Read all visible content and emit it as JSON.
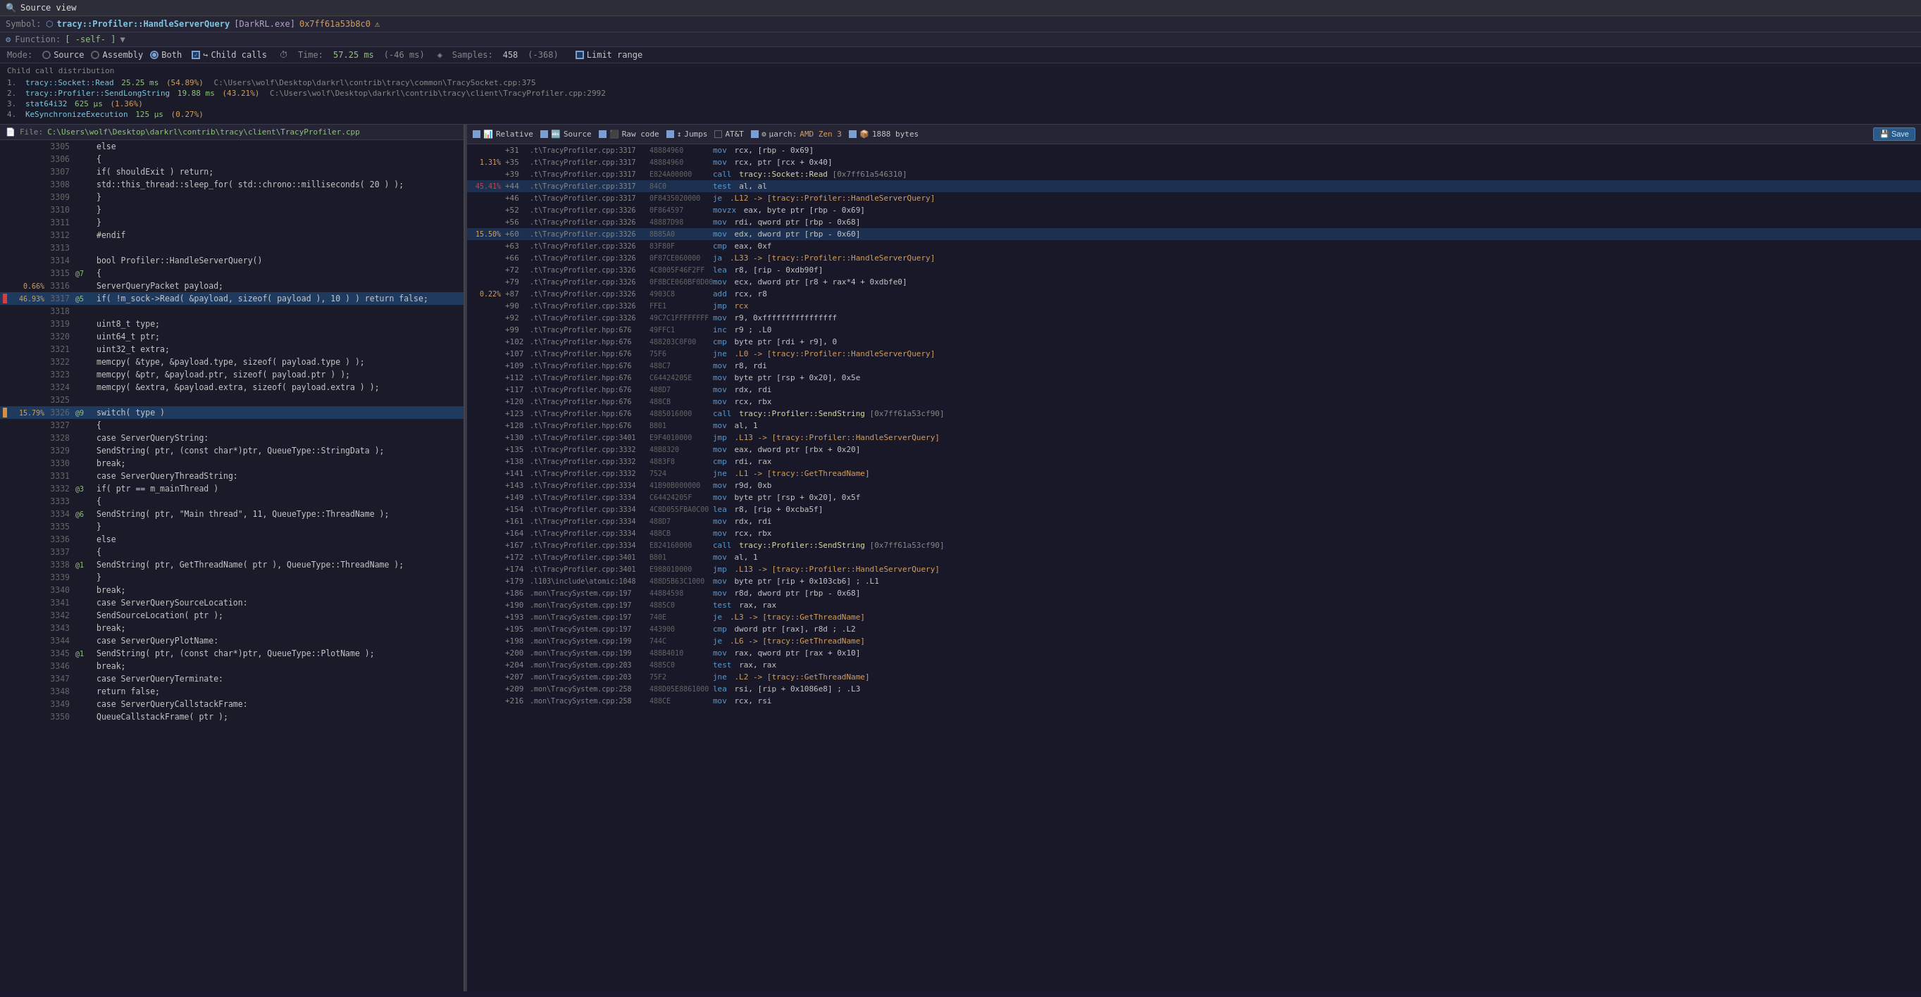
{
  "titleBar": {
    "icon": "👁",
    "title": "Source view"
  },
  "symbolBar": {
    "label": "Symbol:",
    "name": "tracy::Profiler::HandleServerQuery",
    "module": "[DarkRL.exe]",
    "addr": "0x7ff61a53b8c0",
    "warnIcon": "⚠"
  },
  "functionBar": {
    "label": "Function:",
    "value": "[ -self- ]",
    "dropdown": true
  },
  "modeBar": {
    "modeLabel": "Mode:",
    "modes": [
      {
        "id": "source",
        "label": "Source",
        "active": false
      },
      {
        "id": "assembly",
        "label": "Assembly",
        "active": false
      },
      {
        "id": "both",
        "label": "Both",
        "active": true
      }
    ],
    "childCalls": {
      "label": "Child calls",
      "checked": true
    },
    "time": {
      "label": "Time:",
      "value": "57.25 ms",
      "delta": "(-46 ms)"
    },
    "samples": {
      "label": "Samples:",
      "value": "458",
      "delta": "(-368)"
    },
    "limitRange": {
      "label": "Limit range",
      "checked": false
    }
  },
  "childCallsDist": {
    "header": "Child call distribution",
    "items": [
      {
        "num": "1.",
        "func": "tracy::Socket::Read",
        "time": "25.25 ms",
        "pct": "(54.89%)",
        "path": "C:\\Users\\wolf\\Desktop\\darkrl\\contrib\\tracy\\common\\TracySocket.cpp:375"
      },
      {
        "num": "2.",
        "func": "tracy::Profiler::SendLongString",
        "time": "19.88 ms",
        "pct": "(43.21%)",
        "path": "C:\\Users\\wolf\\Desktop\\darkrl\\contrib\\tracy\\client\\TracyProfiler.cpp:2992"
      },
      {
        "num": "3.",
        "func": "stat64i32",
        "time": "625 μs",
        "pct": "(1.36%)",
        "path": ""
      },
      {
        "num": "4.",
        "func": "KeSynchronizeExecution",
        "time": "125 μs",
        "pct": "(0.27%)",
        "path": ""
      }
    ]
  },
  "sourcePanel": {
    "fileLabel": "File:",
    "filePath": "C:\\Users\\wolf\\Desktop\\darkrl\\contrib\\tracy\\client\\TracyProfiler.cpp",
    "lines": [
      {
        "num": 3305,
        "pct": "",
        "annot": "",
        "code": "else",
        "indent": 3
      },
      {
        "num": 3306,
        "pct": "",
        "annot": "",
        "code": "{",
        "indent": 4
      },
      {
        "num": 3307,
        "pct": "",
        "annot": "",
        "code": "if( shouldExit ) return;",
        "indent": 5
      },
      {
        "num": 3308,
        "pct": "",
        "annot": "",
        "code": "std::this_thread::sleep_for( std::chrono::milliseconds( 20 ) );",
        "indent": 5
      },
      {
        "num": 3309,
        "pct": "",
        "annot": "",
        "code": "}",
        "indent": 4
      },
      {
        "num": 3310,
        "pct": "",
        "annot": "",
        "code": "}",
        "indent": 3
      },
      {
        "num": 3311,
        "pct": "",
        "annot": "",
        "code": "}",
        "indent": 2
      },
      {
        "num": 3312,
        "pct": "",
        "annot": "",
        "code": "#endif",
        "indent": 1
      },
      {
        "num": 3313,
        "pct": "",
        "annot": "",
        "code": "",
        "indent": 0
      },
      {
        "num": 3314,
        "pct": "",
        "annot": "",
        "code": "bool Profiler::HandleServerQuery()",
        "indent": 1
      },
      {
        "num": 3315,
        "pct": "",
        "annot": "@7",
        "code": "{",
        "indent": 1
      },
      {
        "num": 3316,
        "pct": "0.66%",
        "annot": "",
        "code": "ServerQueryPacket payload;",
        "indent": 2
      },
      {
        "num": 3317,
        "pct": "46.93%",
        "annot": "@5",
        "code": "if( !m_sock->Read( &payload, sizeof( payload ), 10 ) ) return false;",
        "indent": 2,
        "hot": true
      },
      {
        "num": 3318,
        "pct": "",
        "annot": "",
        "code": "",
        "indent": 0
      },
      {
        "num": 3319,
        "pct": "",
        "annot": "",
        "code": "uint8_t type;",
        "indent": 2
      },
      {
        "num": 3320,
        "pct": "",
        "annot": "",
        "code": "uint64_t ptr;",
        "indent": 2
      },
      {
        "num": 3321,
        "pct": "",
        "annot": "",
        "code": "uint32_t extra;",
        "indent": 2
      },
      {
        "num": 3322,
        "pct": "",
        "annot": "",
        "code": "memcpy( &type, &payload.type, sizeof( payload.type ) );",
        "indent": 2
      },
      {
        "num": 3323,
        "pct": "",
        "annot": "",
        "code": "memcpy( &ptr, &payload.ptr, sizeof( payload.ptr ) );",
        "indent": 2
      },
      {
        "num": 3324,
        "pct": "",
        "annot": "",
        "code": "memcpy( &extra, &payload.extra, sizeof( payload.extra ) );",
        "indent": 2
      },
      {
        "num": 3325,
        "pct": "",
        "annot": "",
        "code": "",
        "indent": 0
      },
      {
        "num": 3326,
        "pct": "15.79%",
        "annot": "@9",
        "code": "switch( type )",
        "indent": 2,
        "warm": true
      },
      {
        "num": 3327,
        "pct": "",
        "annot": "",
        "code": "{",
        "indent": 2
      },
      {
        "num": 3328,
        "pct": "",
        "annot": "",
        "code": "case ServerQueryString:",
        "indent": 2
      },
      {
        "num": 3329,
        "pct": "",
        "annot": "",
        "code": "SendString( ptr, (const char*)ptr, QueueType::StringData );",
        "indent": 3
      },
      {
        "num": 3330,
        "pct": "",
        "annot": "",
        "code": "break;",
        "indent": 3
      },
      {
        "num": 3331,
        "pct": "",
        "annot": "",
        "code": "case ServerQueryThreadString:",
        "indent": 2
      },
      {
        "num": 3332,
        "pct": "",
        "annot": "@3",
        "code": "if( ptr == m_mainThread )",
        "indent": 3
      },
      {
        "num": 3333,
        "pct": "",
        "annot": "",
        "code": "{",
        "indent": 4
      },
      {
        "num": 3334,
        "pct": "",
        "annot": "@6",
        "code": "SendString( ptr, \"Main thread\", 11, QueueType::ThreadName );",
        "indent": 4
      },
      {
        "num": 3335,
        "pct": "",
        "annot": "",
        "code": "}",
        "indent": 4
      },
      {
        "num": 3336,
        "pct": "",
        "annot": "",
        "code": "else",
        "indent": 3
      },
      {
        "num": 3337,
        "pct": "",
        "annot": "",
        "code": "{",
        "indent": 4
      },
      {
        "num": 3338,
        "pct": "",
        "annot": "@1",
        "code": "SendString( ptr, GetThreadName( ptr ), QueueType::ThreadName );",
        "indent": 4
      },
      {
        "num": 3339,
        "pct": "",
        "annot": "",
        "code": "}",
        "indent": 4
      },
      {
        "num": 3340,
        "pct": "",
        "annot": "",
        "code": "break;",
        "indent": 3
      },
      {
        "num": 3341,
        "pct": "",
        "annot": "",
        "code": "case ServerQuerySourceLocation:",
        "indent": 2
      },
      {
        "num": 3342,
        "pct": "",
        "annot": "",
        "code": "SendSourceLocation( ptr );",
        "indent": 3
      },
      {
        "num": 3343,
        "pct": "",
        "annot": "",
        "code": "break;",
        "indent": 3
      },
      {
        "num": 3344,
        "pct": "",
        "annot": "",
        "code": "case ServerQueryPlotName:",
        "indent": 2
      },
      {
        "num": 3345,
        "pct": "",
        "annot": "@1",
        "code": "SendString( ptr, (const char*)ptr, QueueType::PlotName );",
        "indent": 3
      },
      {
        "num": 3346,
        "pct": "",
        "annot": "",
        "code": "break;",
        "indent": 3
      },
      {
        "num": 3347,
        "pct": "",
        "annot": "",
        "code": "case ServerQueryTerminate:",
        "indent": 2
      },
      {
        "num": 3348,
        "pct": "",
        "annot": "",
        "code": "return false;",
        "indent": 3
      },
      {
        "num": 3349,
        "pct": "",
        "annot": "",
        "code": "case ServerQueryCallstackFrame:",
        "indent": 2
      },
      {
        "num": 3350,
        "pct": "",
        "annot": "",
        "code": "QueueCallstackFrame( ptr );",
        "indent": 3
      }
    ]
  },
  "asmPanel": {
    "toggles": [
      {
        "id": "relative",
        "label": "Relative",
        "checked": true,
        "icon": "📊"
      },
      {
        "id": "source",
        "label": "Source",
        "checked": true,
        "icon": "📄"
      },
      {
        "id": "rawcode",
        "label": "Raw code",
        "checked": true,
        "icon": "🔤"
      },
      {
        "id": "jumps",
        "label": "Jumps",
        "checked": true,
        "icon": "↕"
      },
      {
        "id": "att",
        "label": "AT&T",
        "checked": false
      },
      {
        "id": "uarch",
        "label": "μarch:",
        "value": "AMD Zen 3",
        "checked": true,
        "icon": "⚙"
      },
      {
        "id": "bytes",
        "label": "1888 bytes",
        "checked": true
      },
      {
        "id": "save",
        "label": "Save",
        "isButton": true
      }
    ],
    "lines": [
      {
        "offset": "+31",
        "src": ".t\\TracyProfiler.cpp:3317",
        "bytes": "48884960",
        "pct": "",
        "instr": "mov",
        "ops": "rcx, [rbp - 0x69]"
      },
      {
        "offset": "+35",
        "src": ".t\\TracyProfiler.cpp:3317",
        "bytes": "48884960",
        "pct": "1.31%",
        "instr": "mov",
        "ops": "rcx, ptr [rcx + 0x40]"
      },
      {
        "offset": "+39",
        "src": ".t\\TracyProfiler.cpp:3317",
        "bytes": "E824A00000",
        "pct": "",
        "instr": "call",
        "ops": "tracy::Socket::Read [0x7ff61a546310]"
      },
      {
        "offset": "+44",
        "src": ".t\\TracyProfiler.cpp:3317",
        "bytes": "84C0",
        "pct": "45.41%",
        "instr": "test",
        "ops": "al, al",
        "hot": true
      },
      {
        "offset": "+46",
        "src": ".t\\TracyProfiler.cpp:3317",
        "bytes": "0F8435020000",
        "pct": "",
        "instr": "je",
        "ops": ".L12 -> [tracy::Profiler::HandleServerQuery]"
      },
      {
        "offset": "+52",
        "src": ".t\\TracyProfiler.cpp:3326",
        "bytes": "0F864597",
        "pct": "",
        "instr": "movzx",
        "ops": "eax, byte ptr [rbp - 0x69]"
      },
      {
        "offset": "+56",
        "src": ".t\\TracyProfiler.cpp:3326",
        "bytes": "48887D98",
        "pct": "",
        "instr": "mov",
        "ops": "rdi, qword ptr [rbp - 0x68]"
      },
      {
        "offset": "+60",
        "src": ".t\\TracyProfiler.cpp:3326",
        "bytes": "8B85A0",
        "pct": "15.50%",
        "instr": "mov",
        "ops": "edx, dword ptr [rbp - 0x60]",
        "warm": true
      },
      {
        "offset": "+63",
        "src": ".t\\TracyProfiler.cpp:3326",
        "bytes": "83F80F",
        "pct": "",
        "instr": "cmp",
        "ops": "eax, 0xf"
      },
      {
        "offset": "+66",
        "src": ".t\\TracyProfiler.cpp:3326",
        "bytes": "0F87CE060000",
        "pct": "",
        "instr": "ja",
        "ops": ".L33 -> [tracy::Profiler::HandleServerQuery]"
      },
      {
        "offset": "+72",
        "src": ".t\\TracyProfiler.cpp:3326",
        "bytes": "4C8005F46F2FF",
        "pct": "",
        "instr": "lea",
        "ops": "r8, [rip - 0xdb90f]"
      },
      {
        "offset": "+79",
        "src": ".t\\TracyProfiler.cpp:3326",
        "bytes": "0F8BCE060BF0D00",
        "pct": "",
        "instr": "mov",
        "ops": "ecx, dword ptr [r8 + rax*4 + 0xdbfe0]"
      },
      {
        "offset": "+87",
        "src": ".t\\TracyProfiler.cpp:3326",
        "bytes": "4903C8",
        "pct": "0.22%",
        "instr": "add",
        "ops": "rcx, r8"
      },
      {
        "offset": "+90",
        "src": ".t\\TracyProfiler.cpp:3326",
        "bytes": "FFE1",
        "pct": "",
        "instr": "jmp",
        "ops": "rcx"
      },
      {
        "offset": "+92",
        "src": ".t\\TracyProfiler.cpp:3326",
        "bytes": "49C7C1FFFFFFFF",
        "pct": "",
        "instr": "mov",
        "ops": "r9, 0xffffffffffffffff"
      },
      {
        "offset": "+99",
        "src": ".t\\TracyProfiler.hpp:676",
        "bytes": "49FFC1",
        "pct": "",
        "instr": "inc",
        "ops": "r9 ; .L0"
      },
      {
        "offset": "+102",
        "src": ".t\\TracyProfiler.hpp:676",
        "bytes": "488203C0F00",
        "pct": "",
        "instr": "cmp",
        "ops": "byte ptr [rdi + r9], 0"
      },
      {
        "offset": "+107",
        "src": ".t\\TracyProfiler.hpp:676",
        "bytes": "75F6",
        "pct": "",
        "instr": "jne",
        "ops": ".L0 -> [tracy::Profiler::HandleServerQuery]"
      },
      {
        "offset": "+109",
        "src": ".t\\TracyProfiler.hpp:676",
        "bytes": "488C7",
        "pct": "",
        "instr": "mov",
        "ops": "r8, rdi"
      },
      {
        "offset": "+112",
        "src": ".t\\TracyProfiler.hpp:676",
        "bytes": "C64424205E",
        "pct": "",
        "instr": "mov",
        "ops": "byte ptr [rsp + 0x20], 0x5e"
      },
      {
        "offset": "+117",
        "src": ".t\\TracyProfiler.hpp:676",
        "bytes": "488D7",
        "pct": "",
        "instr": "mov",
        "ops": "rdx, rdi"
      },
      {
        "offset": "+120",
        "src": ".t\\TracyProfiler.hpp:676",
        "bytes": "488CB",
        "pct": "",
        "instr": "mov",
        "ops": "rcx, rbx"
      },
      {
        "offset": "+123",
        "src": ".t\\TracyProfiler.hpp:676",
        "bytes": "4885016000",
        "pct": "",
        "instr": "call",
        "ops": "tracy::Profiler::SendString [0x7ff61a53cf90]"
      },
      {
        "offset": "+128",
        "src": ".t\\TracyProfiler.hpp:676",
        "bytes": "B801",
        "pct": "",
        "instr": "mov",
        "ops": "al, 1"
      },
      {
        "offset": "+130",
        "src": ".t\\TracyProfiler.cpp:3401",
        "bytes": "E9F4010000",
        "pct": "",
        "instr": "jmp",
        "ops": ".L13 -> [tracy::Profiler::HandleServerQuery]"
      },
      {
        "offset": "+135",
        "src": ".t\\TracyProfiler.cpp:3332",
        "bytes": "48B8320",
        "pct": "",
        "instr": "mov",
        "ops": "eax, dword ptr [rbx + 0x20]"
      },
      {
        "offset": "+138",
        "src": ".t\\TracyProfiler.cpp:3332",
        "bytes": "4883F8",
        "pct": "",
        "instr": "cmp",
        "ops": "rdi, rax"
      },
      {
        "offset": "+141",
        "src": ".t\\TracyProfiler.cpp:3332",
        "bytes": "7524",
        "pct": "",
        "instr": "jne",
        "ops": ".L1 -> [tracy::GetThreadName]"
      },
      {
        "offset": "+143",
        "src": ".t\\TracyProfiler.cpp:3334",
        "bytes": "41B90B000000",
        "pct": "",
        "instr": "mov",
        "ops": "r9d, 0xb"
      },
      {
        "offset": "+149",
        "src": ".t\\TracyProfiler.cpp:3334",
        "bytes": "C64424205F",
        "pct": "",
        "instr": "mov",
        "ops": "byte ptr [rsp + 0x20], 0x5f"
      },
      {
        "offset": "+154",
        "src": ".t\\TracyProfiler.cpp:3334",
        "bytes": "4C8D055FBA0C00",
        "pct": "",
        "instr": "lea",
        "ops": "r8, [rip + 0xcba5f]"
      },
      {
        "offset": "+161",
        "src": ".t\\TracyProfiler.cpp:3334",
        "bytes": "488D7",
        "pct": "",
        "instr": "mov",
        "ops": "rdx, rdi"
      },
      {
        "offset": "+164",
        "src": ".t\\TracyProfiler.cpp:3334",
        "bytes": "488CB",
        "pct": "",
        "instr": "mov",
        "ops": "rcx, rbx"
      },
      {
        "offset": "+167",
        "src": ".t\\TracyProfiler.cpp:3334",
        "bytes": "E824160000",
        "pct": "",
        "instr": "call",
        "ops": "tracy::Profiler::SendString [0x7ff61a53cf90]"
      },
      {
        "offset": "+172",
        "src": ".t\\TracyProfiler.cpp:3401",
        "bytes": "B801",
        "pct": "",
        "instr": "mov",
        "ops": "al, 1"
      },
      {
        "offset": "+174",
        "src": ".t\\TracyProfiler.cpp:3401",
        "bytes": "E988010000",
        "pct": "",
        "instr": "jmp",
        "ops": ".L13 -> [tracy::Profiler::HandleServerQuery]"
      },
      {
        "offset": "+179",
        "src": ".l103\\include\\atomic:1048",
        "bytes": "488D5B63C1000",
        "pct": "",
        "instr": "mov",
        "ops": "byte ptr [rip + 0x103cb6] ; .L1"
      },
      {
        "offset": "+186",
        "src": ".mon\\TracySystem.cpp:197",
        "bytes": "44884598",
        "pct": "",
        "instr": "mov",
        "ops": "r8d, dword ptr [rbp - 0x68]"
      },
      {
        "offset": "+190",
        "src": ".mon\\TracySystem.cpp:197",
        "bytes": "4885C0",
        "pct": "",
        "instr": "test",
        "ops": "rax, rax"
      },
      {
        "offset": "+193",
        "src": ".mon\\TracySystem.cpp:197",
        "bytes": "740E",
        "pct": "",
        "instr": "je",
        "ops": ".L3 -> [tracy::GetThreadName]"
      },
      {
        "offset": "+195",
        "src": ".mon\\TracySystem.cpp:197",
        "bytes": "443900",
        "pct": "",
        "instr": "cmp",
        "ops": "dword ptr [rax], r8d ; .L2"
      },
      {
        "offset": "+198",
        "src": ".mon\\TracySystem.cpp:199",
        "bytes": "744C",
        "pct": "",
        "instr": "je",
        "ops": ".L6 -> [tracy::GetThreadName]"
      },
      {
        "offset": "+200",
        "src": ".mon\\TracySystem.cpp:199",
        "bytes": "488B4010",
        "pct": "",
        "instr": "mov",
        "ops": "rax, qword ptr [rax + 0x10]"
      },
      {
        "offset": "+204",
        "src": ".mon\\TracySystem.cpp:203",
        "bytes": "4885C0",
        "pct": "",
        "instr": "test",
        "ops": "rax, rax"
      },
      {
        "offset": "+207",
        "src": ".mon\\TracySystem.cpp:203",
        "bytes": "75F2",
        "pct": "",
        "instr": "jne",
        "ops": ".L2 -> [tracy::GetThreadName]"
      },
      {
        "offset": "+209",
        "src": ".mon\\TracySystem.cpp:258",
        "bytes": "488D05E8861000",
        "pct": "",
        "instr": "lea",
        "ops": "rsi, [rip + 0x1086e8] ; .L3"
      },
      {
        "offset": "+216",
        "src": ".mon\\TracySystem.cpp:258",
        "bytes": "488CE",
        "pct": "",
        "instr": "mov",
        "ops": "rcx, rsi"
      }
    ]
  }
}
